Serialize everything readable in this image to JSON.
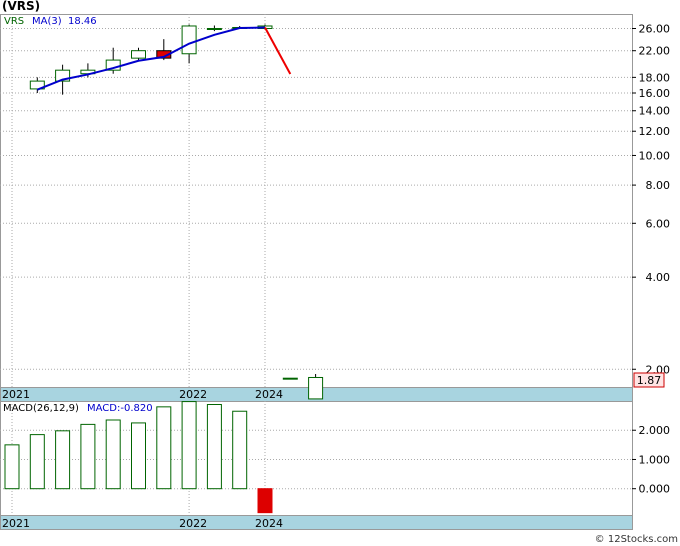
{
  "chart_data": {
    "type": "candlestick",
    "title": "(VRS)",
    "price_panel": {
      "ticker_label": "VRS",
      "ma_label": "MA(3)",
      "ma_value": "18.46",
      "last_price": "1.87",
      "y_scale": "log",
      "ylim": [
        1.75,
        29
      ],
      "y_ticks": [
        {
          "v": 26,
          "label": "26.00"
        },
        {
          "v": 22,
          "label": "22.00"
        },
        {
          "v": 18,
          "label": "18.00"
        },
        {
          "v": 16,
          "label": "16.00"
        },
        {
          "v": 14,
          "label": "14.00"
        },
        {
          "v": 12,
          "label": "12.00"
        },
        {
          "v": 10,
          "label": "10.00"
        },
        {
          "v": 8,
          "label": "8.00"
        },
        {
          "v": 6,
          "label": "6.00"
        },
        {
          "v": 4,
          "label": "4.00"
        },
        {
          "v": 2,
          "label": "2.00"
        }
      ],
      "candles": [
        {
          "x": 1,
          "open": 16.5,
          "close": 17.5,
          "high": 18.0,
          "low": 16.0,
          "color": "up"
        },
        {
          "x": 2,
          "open": 17.5,
          "close": 19.0,
          "high": 19.8,
          "low": 15.8,
          "color": "up"
        },
        {
          "x": 3,
          "open": 18.5,
          "close": 19.0,
          "high": 20.0,
          "low": 18.0,
          "color": "up"
        },
        {
          "x": 4,
          "open": 19.0,
          "close": 20.5,
          "high": 22.5,
          "low": 18.5,
          "color": "up"
        },
        {
          "x": 5,
          "open": 20.8,
          "close": 22.0,
          "high": 22.5,
          "low": 20.5,
          "color": "up"
        },
        {
          "x": 6,
          "open": 22.0,
          "close": 20.8,
          "high": 24.0,
          "low": 20.5,
          "color": "down"
        },
        {
          "x": 7,
          "open": 21.5,
          "close": 26.5,
          "high": 26.8,
          "low": 20.0,
          "color": "up"
        },
        {
          "x": 8,
          "open": 26.0,
          "close": 26.0,
          "high": 26.6,
          "low": 25.5,
          "color": "up"
        },
        {
          "x": 9,
          "open": 26.2,
          "close": 26.2,
          "high": 26.5,
          "low": 25.9,
          "color": "up"
        },
        {
          "x": 10,
          "open": 26.0,
          "close": 26.5,
          "high": 26.8,
          "low": 25.8,
          "color": "up"
        },
        {
          "x": 11,
          "open": 1.87,
          "close": 1.87,
          "high": 1.87,
          "low": 1.87,
          "color": "up"
        },
        {
          "x": 12,
          "open": 1.6,
          "close": 1.88,
          "high": 1.93,
          "low": 1.6,
          "color": "up"
        }
      ],
      "ma_line": [
        {
          "x": 1,
          "y": 16.4
        },
        {
          "x": 2,
          "y": 17.7
        },
        {
          "x": 3,
          "y": 18.4
        },
        {
          "x": 4,
          "y": 19.3
        },
        {
          "x": 5,
          "y": 20.4
        },
        {
          "x": 6,
          "y": 21.0
        },
        {
          "x": 7,
          "y": 23.2
        },
        {
          "x": 8,
          "y": 24.8
        },
        {
          "x": 9,
          "y": 26.1
        },
        {
          "x": 10,
          "y": 26.2
        },
        {
          "x": 11,
          "y": 18.46
        }
      ],
      "ma_down_from_x": 10
    },
    "macd_panel": {
      "label": "MACD(26,12,9)",
      "value_label": "MACD:-0.820",
      "ylim": [
        -0.9,
        3.0
      ],
      "y_ticks": [
        {
          "v": 2,
          "label": "2.000"
        },
        {
          "v": 1,
          "label": "1.000"
        },
        {
          "v": 0,
          "label": "0.000"
        }
      ],
      "bars": [
        {
          "x": 0,
          "v": 1.5
        },
        {
          "x": 1,
          "v": 1.85
        },
        {
          "x": 2,
          "v": 1.98
        },
        {
          "x": 3,
          "v": 2.2
        },
        {
          "x": 4,
          "v": 2.35
        },
        {
          "x": 5,
          "v": 2.25
        },
        {
          "x": 6,
          "v": 2.8
        },
        {
          "x": 7,
          "v": 2.98
        },
        {
          "x": 8,
          "v": 2.88
        },
        {
          "x": 9,
          "v": 2.65
        },
        {
          "x": 10,
          "v": -0.82
        }
      ]
    },
    "x_year_labels": [
      {
        "x": 0,
        "label": "2021"
      },
      {
        "x": 7,
        "label": "2022"
      },
      {
        "x": 10,
        "label": "2024"
      }
    ],
    "colors": {
      "up_fill": "#ffffff",
      "up_stroke": "#006400",
      "down_fill": "#dd0000",
      "ma_line": "#0000cc",
      "ma_down": "#ee0000",
      "axis_band": "#a8d4e0",
      "grid": "#aaaaaa",
      "last_price_bg": "#ffe4e4",
      "last_price_fg": "#cc0000"
    },
    "watermark": "© 12Stocks.com"
  }
}
